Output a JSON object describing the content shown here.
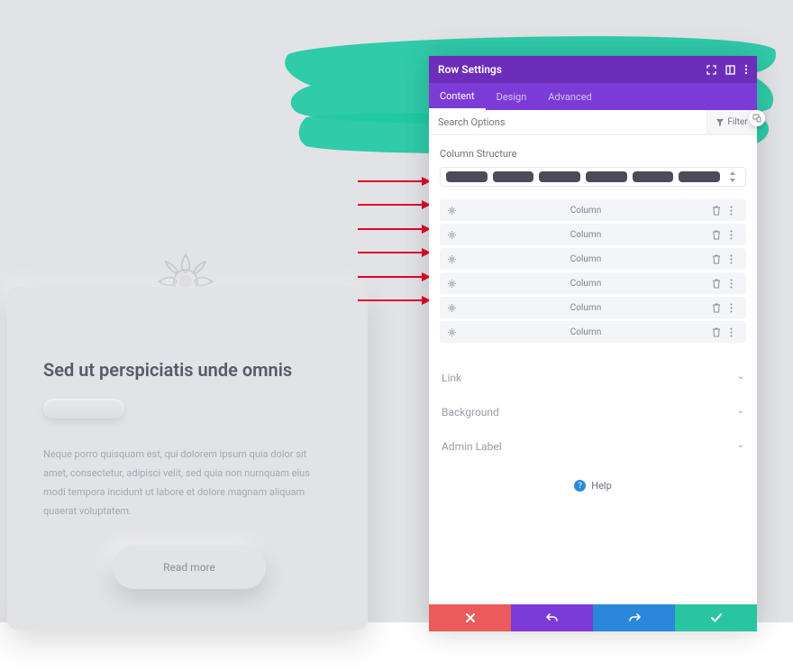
{
  "card": {
    "heading": "Sed ut perspiciatis unde omnis",
    "body": "Neque porro quisquam est, qui dolorem ipsum quia dolor sit amet, consectetur, adipisci velit, sed quia non numquam eius modi tempora incidunt ut labore et dolore magnam aliquam quaerat voluptatem.",
    "cta": "Read more"
  },
  "modal": {
    "title": "Row Settings",
    "tabs": {
      "content": "Content",
      "design": "Design",
      "advanced": "Advanced"
    },
    "search_placeholder": "Search Options",
    "filter_label": "Filter",
    "section_structure": "Column Structure",
    "columns": [
      {
        "label": "Column"
      },
      {
        "label": "Column"
      },
      {
        "label": "Column"
      },
      {
        "label": "Column"
      },
      {
        "label": "Column"
      },
      {
        "label": "Column"
      }
    ],
    "accordions": {
      "link": "Link",
      "background": "Background",
      "admin_label": "Admin Label"
    },
    "help": "Help"
  },
  "colors": {
    "accent_purple": "#7c3bd6",
    "accent_purple_dark": "#6c2eb9",
    "teal": "#21c9a4",
    "red": "#eb5b5b",
    "blue": "#2b87da",
    "green": "#29c4a0"
  }
}
